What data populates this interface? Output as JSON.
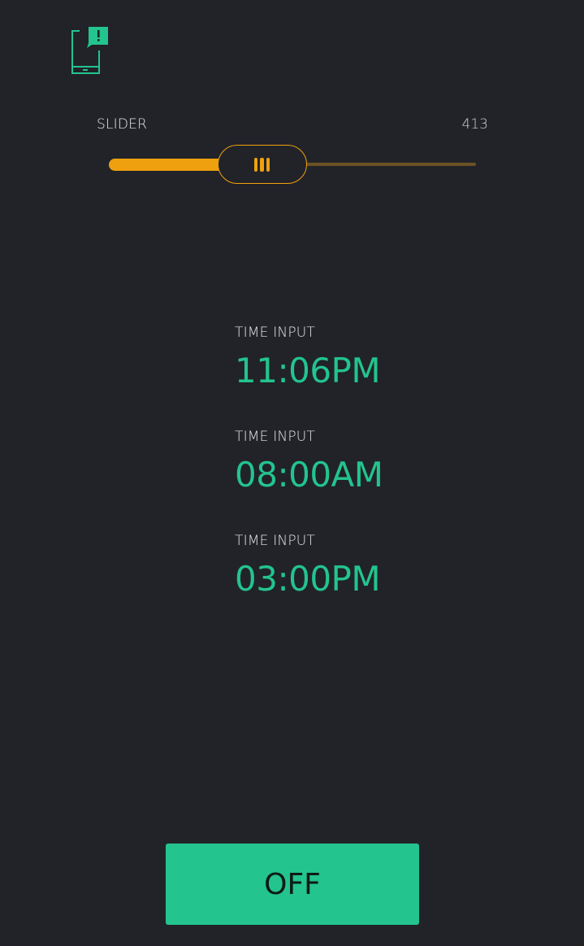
{
  "header": {
    "notification_icon": "phone-notification-icon"
  },
  "slider": {
    "label": "SLIDER",
    "value": "413",
    "min": 0,
    "max": 1023,
    "fraction": 0.403
  },
  "time_inputs": [
    {
      "label": "TIME INPUT",
      "value": "11:06PM"
    },
    {
      "label": "TIME INPUT",
      "value": "08:00AM"
    },
    {
      "label": "TIME INPUT",
      "value": "03:00PM"
    }
  ],
  "button": {
    "label": "OFF"
  },
  "colors": {
    "background": "#212328",
    "accent_green": "#23c48e",
    "accent_orange": "#efa00f",
    "text_light": "#e6e6e6"
  }
}
